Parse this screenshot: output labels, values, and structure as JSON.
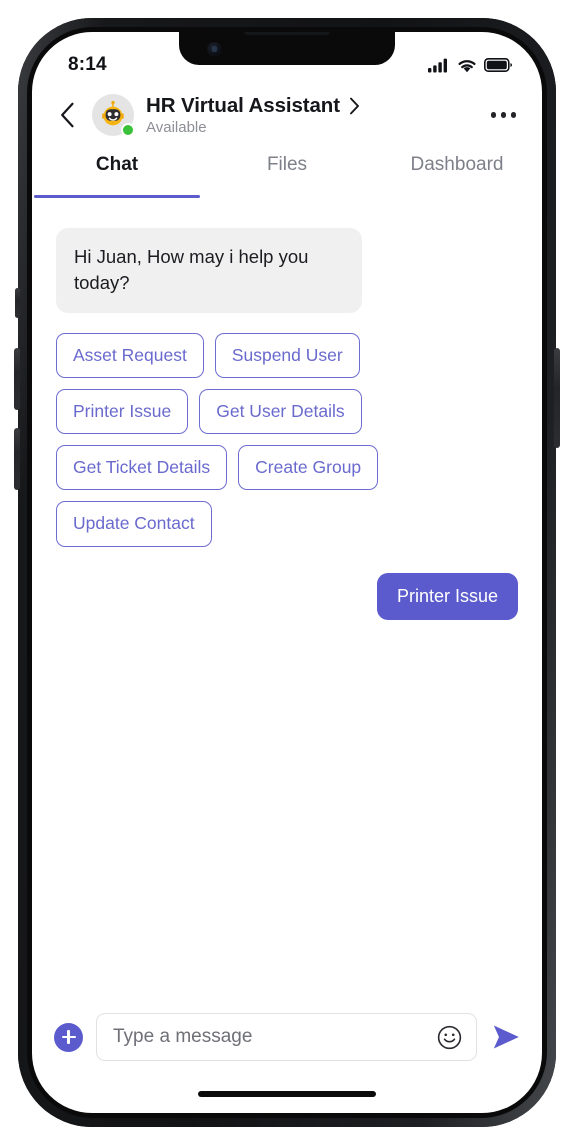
{
  "status_bar": {
    "time": "8:14",
    "icons": [
      "signal-icon",
      "wifi-icon",
      "battery-icon"
    ]
  },
  "header": {
    "back_icon": "chevron-left-icon",
    "avatar_icon": "robot-avatar",
    "presence": "online",
    "title": "HR Virtual Assistant",
    "title_chevron": "chevron-right-icon",
    "subtitle": "Available",
    "more_icon": "more-horizontal-icon"
  },
  "tabs": [
    {
      "label": "Chat",
      "active": true
    },
    {
      "label": "Files",
      "active": false
    },
    {
      "label": "Dashboard",
      "active": false
    }
  ],
  "conversation": {
    "incoming_message": "Hi Juan, How may i help you today?",
    "quick_replies": [
      "Asset Request",
      "Suspend User",
      "Printer Issue",
      "Get User Details",
      "Get Ticket Details",
      "Create Group",
      "Update Contact"
    ],
    "outgoing_message": "Printer Issue"
  },
  "composer": {
    "add_icon": "plus-circle-icon",
    "placeholder": "Type a message",
    "value": "",
    "emoji_icon": "smiley-icon",
    "send_icon": "send-arrow-icon"
  },
  "colors": {
    "accent": "#5b5bce",
    "chip_border": "#6d6dd1",
    "chip_text": "#6a6ace",
    "incoming_bubble": "#f0f0f1",
    "online": "#3cc13b",
    "tab_inactive": "#7e8089"
  }
}
